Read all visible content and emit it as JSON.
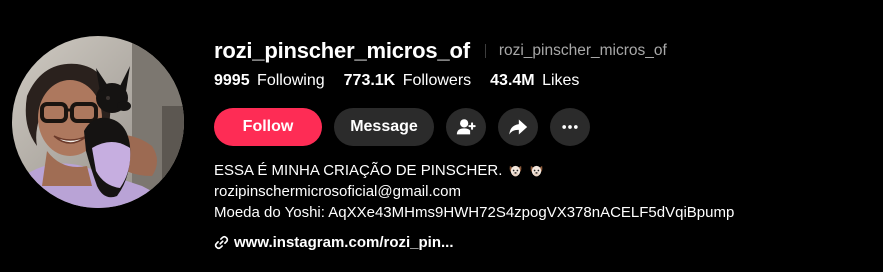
{
  "profile": {
    "username": "rozi_pinscher_micros_of",
    "nickname": "rozi_pinscher_micros_of",
    "avatar_icon": "profile-photo-woman-with-pinscher-dog"
  },
  "stats": {
    "following_count": "9995",
    "following_label": "Following",
    "followers_count": "773.1K",
    "followers_label": "Followers",
    "likes_count": "43.4M",
    "likes_label": "Likes"
  },
  "actions": {
    "follow_label": "Follow",
    "message_label": "Message",
    "add_friend_icon": "person-add-icon",
    "share_icon": "share-arrow-icon",
    "more_icon": "more-horizontal-icon"
  },
  "bio": {
    "line1": "ESSA É MINHA CRIAÇÃO DE PINSCHER.",
    "line1_emojis": [
      "dog-face-emoji",
      "dog-face-emoji"
    ],
    "line2": "rozipinschermicrosoficial@gmail.com",
    "line3": "Moeda do Yoshi: AqXXe43MHms9HWH72S4zpogVX378nACELF5dVqiBpump"
  },
  "link": {
    "icon": "link-icon",
    "text": "www.instagram.com/rozi_pin..."
  },
  "colors": {
    "background": "#000000",
    "follow_button": "#fe2c55",
    "secondary_button": "#2b2b2b",
    "muted_text": "#a8a8a8"
  }
}
